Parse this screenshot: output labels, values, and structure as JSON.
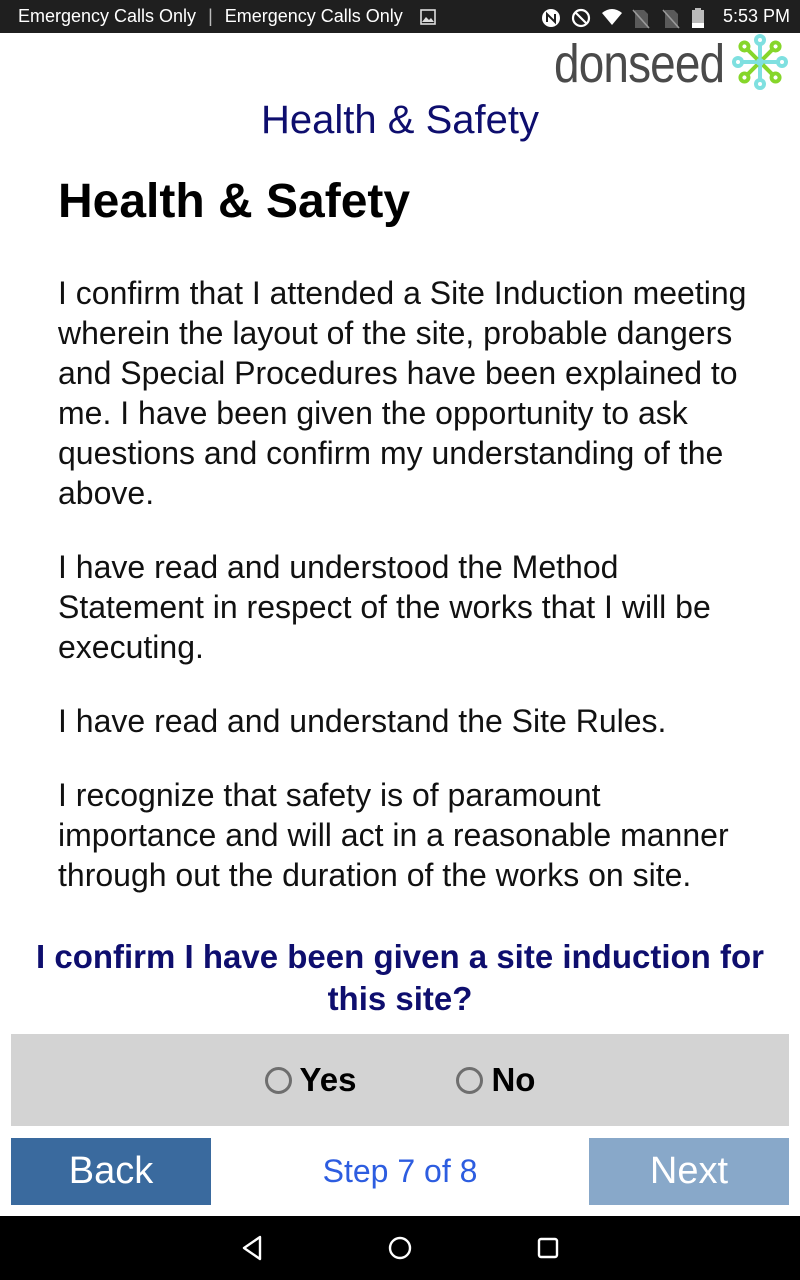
{
  "status_bar": {
    "carrier_1": "Emergency Calls Only",
    "separator": "|",
    "carrier_2": "Emergency Calls Only",
    "time": "5:53 PM",
    "icons": [
      "image-notification-icon",
      "nfc-icon",
      "do-not-disturb-icon",
      "wifi-icon",
      "no-sim-icon",
      "no-sim-icon",
      "battery-icon"
    ]
  },
  "logo": {
    "text": "donseed"
  },
  "app": {
    "title": "Health & Safety"
  },
  "content": {
    "heading": "Health & Safety",
    "paragraphs": [
      "I confirm that I attended a Site Induction meeting wherein the layout of the site, probable dangers and Special Procedures have been explained to me. I have been given the opportunity to ask questions and confirm my understanding of the above.",
      "I have read and understood the Method Statement in respect of the works that I will be executing.",
      "I have read and understand the Site Rules.",
      "I recognize that safety is of paramount importance and will act in a reasonable manner through out the duration of the works on site."
    ]
  },
  "question": {
    "text": "I confirm I have been given a site induction for this site?"
  },
  "options": [
    {
      "label": "Yes",
      "selected": false
    },
    {
      "label": "No",
      "selected": false
    }
  ],
  "navigation": {
    "back_label": "Back",
    "next_label": "Next",
    "step_text": "Step 7 of 8",
    "current_step": 7,
    "total_steps": 8
  },
  "colors": {
    "title": "#0e0e6e",
    "back_button": "#3a6a9e",
    "next_button_disabled": "#88a8c9",
    "step_text": "#2d5de0",
    "radio_panel": "#d3d3d3"
  }
}
